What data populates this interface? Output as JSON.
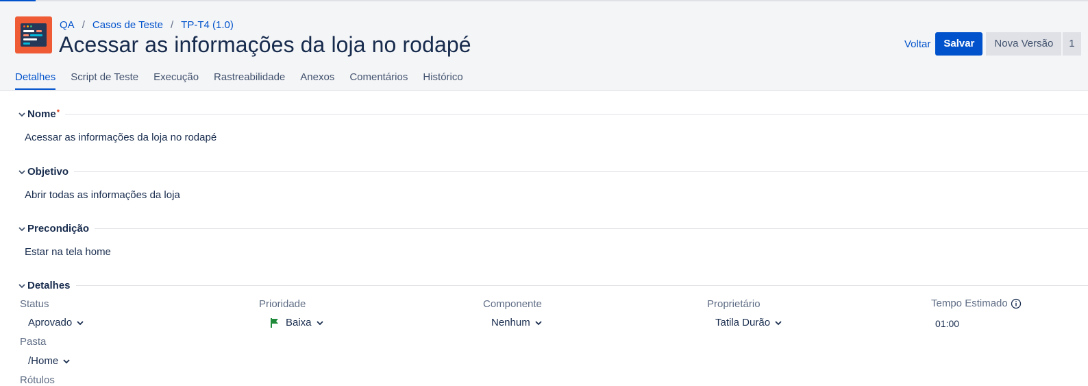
{
  "breadcrumb": {
    "project": "QA",
    "folder": "Casos de Teste",
    "item": "TP-T4 (1.0)",
    "separator": "/"
  },
  "title": "Acessar as informações da loja no rodapé",
  "actions": {
    "back": "Voltar",
    "save": "Salvar",
    "new_version": "Nova Versão",
    "more": "1"
  },
  "tabs": [
    "Detalhes",
    "Script de Teste",
    "Execução",
    "Rastreabilidade",
    "Anexos",
    "Comentários",
    "Histórico"
  ],
  "sections": {
    "name": {
      "label": "Nome",
      "required_mark": "*",
      "value": "Acessar as informações da loja no rodapé"
    },
    "objective": {
      "label": "Objetivo",
      "value": "Abrir todas as informações da loja"
    },
    "precondition": {
      "label": "Precondição",
      "value": "Estar na tela home"
    },
    "details": {
      "label": "Detalhes"
    }
  },
  "fields": {
    "status": {
      "label": "Status",
      "value": "Aprovado"
    },
    "priority": {
      "label": "Prioridade",
      "value": "Baixa",
      "icon": "green-flag-icon"
    },
    "component": {
      "label": "Componente",
      "value": "Nenhum"
    },
    "owner": {
      "label": "Proprietário",
      "value": "Tatila Durão"
    },
    "estimated_time": {
      "label": "Tempo Estimado",
      "value": "01:00",
      "icon": "info-icon"
    },
    "folder": {
      "label": "Pasta",
      "value": "/Home"
    },
    "labels": {
      "label": "Rótulos"
    }
  },
  "colors": {
    "accent": "#0052cc",
    "header_bg": "#f4f5f7",
    "text": "#172b4d",
    "app_icon": "#ef5b35",
    "priority_flag": "#1f8a3a"
  }
}
